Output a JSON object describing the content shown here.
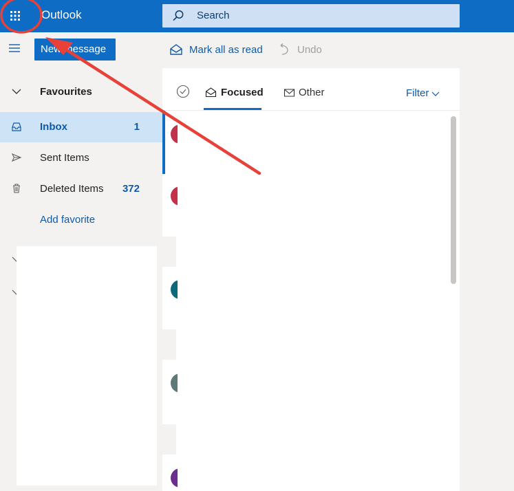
{
  "header": {
    "app_title": "Outlook",
    "search_placeholder": "Search",
    "waffle_icon": "app-launcher-icon"
  },
  "command_bar": {
    "new_message": "New message",
    "mark_all_read": "Mark all as read",
    "undo": "Undo"
  },
  "nav": {
    "favourites": "Favourites",
    "items": [
      {
        "label": "Inbox",
        "count": "1"
      },
      {
        "label": "Sent Items",
        "count": ""
      },
      {
        "label": "Deleted Items",
        "count": "372"
      }
    ],
    "add_favorite": "Add favorite"
  },
  "message_list": {
    "tab_focused": "Focused",
    "tab_other": "Other",
    "filter": "Filter",
    "avatar_colors": [
      "#c4314b",
      "#c4314b",
      "#0b6a7a",
      "#5d7a78",
      "#6b2e8e"
    ]
  },
  "colors": {
    "brand": "#0f6cc4",
    "annotation": "#e8413a"
  }
}
